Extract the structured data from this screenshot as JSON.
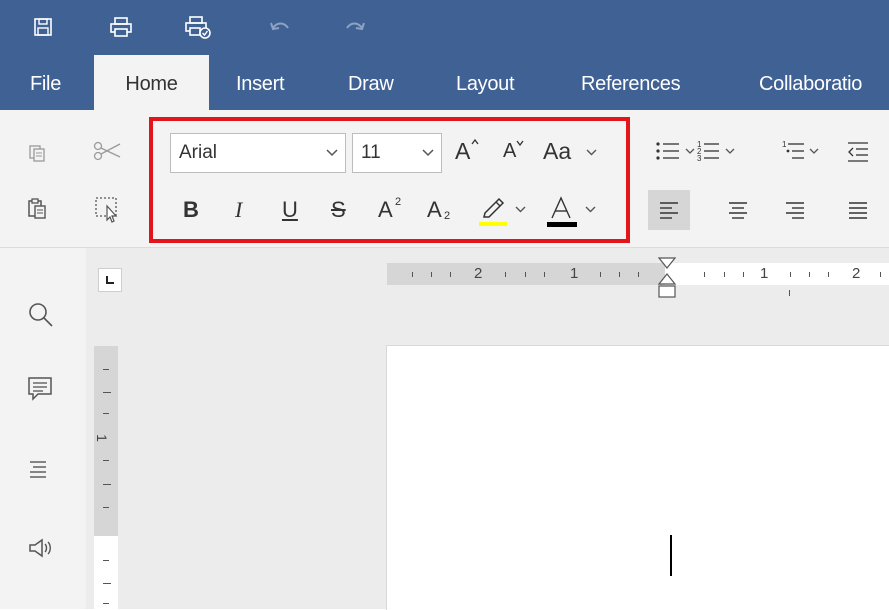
{
  "quick_access": {
    "save_icon": "save-icon",
    "print_icon": "print-icon",
    "print_preview_icon": "print-preview-icon",
    "undo_icon": "undo-icon",
    "redo_icon": "redo-icon"
  },
  "tabs": [
    {
      "label": "File"
    },
    {
      "label": "Home"
    },
    {
      "label": "Insert"
    },
    {
      "label": "Draw"
    },
    {
      "label": "Layout"
    },
    {
      "label": "References"
    },
    {
      "label": "Collaboratio"
    }
  ],
  "ribbon": {
    "font_name": "Arial",
    "font_size": "11",
    "change_case_label": "Aa",
    "bold": "B",
    "italic": "I",
    "underline": "U",
    "strikethrough": "S",
    "superscript_base": "A",
    "superscript_mark": "2",
    "subscript_base": "A",
    "subscript_mark": "2",
    "grow_font": "A",
    "shrink_font": "A",
    "highlight_color": "#ffff00",
    "font_color": "#000000"
  },
  "ruler": {
    "h_labels": [
      "2",
      "1",
      "1",
      "2"
    ],
    "v_labels": [
      "1"
    ]
  },
  "colors": {
    "title_bar": "#3f6193",
    "highlight_box": "#e3151a"
  }
}
